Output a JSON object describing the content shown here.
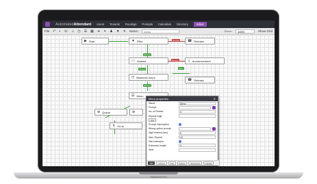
{
  "app": {
    "title_light": "Automated",
    "title_bold": "Attendant"
  },
  "nav": [
    "Users",
    "Tenants",
    "Routings",
    "Prompts",
    "Calendars",
    "Directory",
    "Editor"
  ],
  "toolbar": {
    "file": "File",
    "name_label": "Name:",
    "name_value": "menu",
    "zoom_label": "Zoom:",
    "zoom_value": "100%",
    "show_grid": "Show Grid"
  },
  "nodes": {
    "start": "Start",
    "filter": "Filter",
    "release1": "Release",
    "holdout": "Holdout",
    "announcement": "Announcement",
    "business_hours": "Business hours",
    "release2": "Release",
    "menu": "Menu",
    "queue": "Queue",
    "goto": "Go to"
  },
  "connections": {
    "blocked": "blocked",
    "allowed": "allowed",
    "timeout": "timeout",
    "closed": "closed",
    "open": "open",
    "opened": "opened",
    "no_answer": "timeout"
  },
  "dialog": {
    "title": "Menu properties",
    "rows": [
      {
        "label": "Name",
        "value": "Menu"
      },
      {
        "label": "Prompt",
        "value": ""
      },
      {
        "label": "No. of Retries",
        "value": "3"
      },
      {
        "label": "Repeat Digit",
        "value": ""
      }
    ],
    "list_button": "List",
    "rows2": [
      {
        "label": "Prompt interruption",
        "value": ""
      },
      {
        "label": "Wrong option prompt",
        "value": ""
      },
      {
        "label": "Digit timeout (sec)",
        "value": "5"
      },
      {
        "label": "Max. Repeat",
        "value": "10"
      },
      {
        "label": "Dial extension",
        "value": ""
      },
      {
        "label": "Extension length",
        "value": "4"
      },
      {
        "label": "Note",
        "value": ""
      }
    ],
    "footer": [
      "OK",
      "Cancel",
      "Tab",
      "Delete",
      "Download",
      "Upload"
    ]
  },
  "laptop_label": "MacBook Pro",
  "colors": {
    "accent": "#8c4fb4",
    "topbar": "#2f2f38",
    "green": "#3c9a3c",
    "red": "#c43a3a"
  }
}
